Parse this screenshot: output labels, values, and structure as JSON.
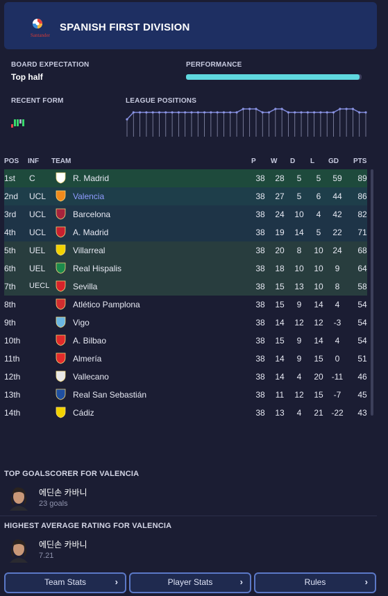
{
  "header": {
    "title": "SPANISH FIRST DIVISION",
    "sponsor": "Santander",
    "accent": "#1e2f62"
  },
  "board": {
    "expectation_label": "BOARD EXPECTATION",
    "expectation_value": "Top half",
    "performance_label": "PERFORMANCE",
    "performance_fraction": 0.99
  },
  "recent_form": {
    "label": "RECENT FORM",
    "results": [
      "L",
      "W",
      "W",
      "D",
      "W"
    ]
  },
  "league_positions": {
    "label": "LEAGUE POSITIONS",
    "values": [
      4,
      2,
      2,
      2,
      2,
      2,
      2,
      2,
      2,
      2,
      2,
      2,
      2,
      2,
      2,
      2,
      2,
      2,
      1,
      1,
      1,
      2,
      2,
      1,
      1,
      2,
      2,
      2,
      2,
      2,
      2,
      2,
      2,
      1,
      1,
      1,
      2,
      2
    ]
  },
  "table": {
    "headers": {
      "pos": "POS",
      "inf": "INF",
      "team": "TEAM",
      "p": "P",
      "w": "W",
      "d": "D",
      "l": "L",
      "gd": "GD",
      "pts": "PTS"
    },
    "rows": [
      {
        "pos": "1st",
        "inf": "C",
        "team": "R. Madrid",
        "p": "38",
        "w": "28",
        "d": "5",
        "l": "5",
        "gd": "59",
        "pts": "89",
        "zone": "ucl1",
        "badge": "real-madrid-crest-icon"
      },
      {
        "pos": "2nd",
        "inf": "UCL",
        "team": "Valencia",
        "p": "38",
        "w": "27",
        "d": "5",
        "l": "6",
        "gd": "44",
        "pts": "86",
        "zone": "ucl2",
        "badge": "valencia-crest-icon",
        "highlight": true
      },
      {
        "pos": "3rd",
        "inf": "UCL",
        "team": "Barcelona",
        "p": "38",
        "w": "24",
        "d": "10",
        "l": "4",
        "gd": "42",
        "pts": "82",
        "zone": "ucl3",
        "badge": "barcelona-crest-icon"
      },
      {
        "pos": "4th",
        "inf": "UCL",
        "team": "A. Madrid",
        "p": "38",
        "w": "19",
        "d": "14",
        "l": "5",
        "gd": "22",
        "pts": "71",
        "zone": "ucl3",
        "badge": "atletico-crest-icon"
      },
      {
        "pos": "5th",
        "inf": "UEL",
        "team": "Villarreal",
        "p": "38",
        "w": "20",
        "d": "8",
        "l": "10",
        "gd": "24",
        "pts": "68",
        "zone": "uel",
        "badge": "villarreal-crest-icon"
      },
      {
        "pos": "6th",
        "inf": "UEL",
        "team": "Real Hispalis",
        "p": "38",
        "w": "18",
        "d": "10",
        "l": "10",
        "gd": "9",
        "pts": "64",
        "zone": "uel",
        "badge": "real-hispalis-crest-icon"
      },
      {
        "pos": "7th",
        "inf": "UECL",
        "team": "Sevilla",
        "p": "38",
        "w": "15",
        "d": "13",
        "l": "10",
        "gd": "8",
        "pts": "58",
        "zone": "uel",
        "badge": "sevilla-crest-icon"
      },
      {
        "pos": "8th",
        "inf": "",
        "team": "Atlético Pamplona",
        "p": "38",
        "w": "15",
        "d": "9",
        "l": "14",
        "gd": "4",
        "pts": "54",
        "zone": "",
        "badge": "pamplona-crest-icon"
      },
      {
        "pos": "9th",
        "inf": "",
        "team": "Vigo",
        "p": "38",
        "w": "14",
        "d": "12",
        "l": "12",
        "gd": "-3",
        "pts": "54",
        "zone": "",
        "badge": "vigo-crest-icon"
      },
      {
        "pos": "10th",
        "inf": "",
        "team": "A. Bilbao",
        "p": "38",
        "w": "15",
        "d": "9",
        "l": "14",
        "gd": "4",
        "pts": "54",
        "zone": "",
        "badge": "bilbao-crest-icon"
      },
      {
        "pos": "11th",
        "inf": "",
        "team": "Almería",
        "p": "38",
        "w": "14",
        "d": "9",
        "l": "15",
        "gd": "0",
        "pts": "51",
        "zone": "",
        "badge": "almeria-crest-icon"
      },
      {
        "pos": "12th",
        "inf": "",
        "team": "Vallecano",
        "p": "38",
        "w": "14",
        "d": "4",
        "l": "20",
        "gd": "-11",
        "pts": "46",
        "zone": "",
        "badge": "vallecano-crest-icon"
      },
      {
        "pos": "13th",
        "inf": "",
        "team": "Real San Sebastián",
        "p": "38",
        "w": "11",
        "d": "12",
        "l": "15",
        "gd": "-7",
        "pts": "45",
        "zone": "",
        "badge": "san-sebastian-crest-icon"
      },
      {
        "pos": "14th",
        "inf": "",
        "team": "Cádiz",
        "p": "38",
        "w": "13",
        "d": "4",
        "l": "21",
        "gd": "-22",
        "pts": "43",
        "zone": "",
        "badge": "cadiz-crest-icon"
      }
    ]
  },
  "top_scorer": {
    "title": "TOP GOALSCORER FOR VALENCIA",
    "name": "에딘손 카바니",
    "stat": "23 goals"
  },
  "top_rating": {
    "title": "HIGHEST AVERAGE RATING FOR VALENCIA",
    "name": "에딘손 카바니",
    "stat": "7.21"
  },
  "buttons": {
    "team_stats": "Team Stats",
    "player_stats": "Player Stats",
    "rules": "Rules"
  }
}
